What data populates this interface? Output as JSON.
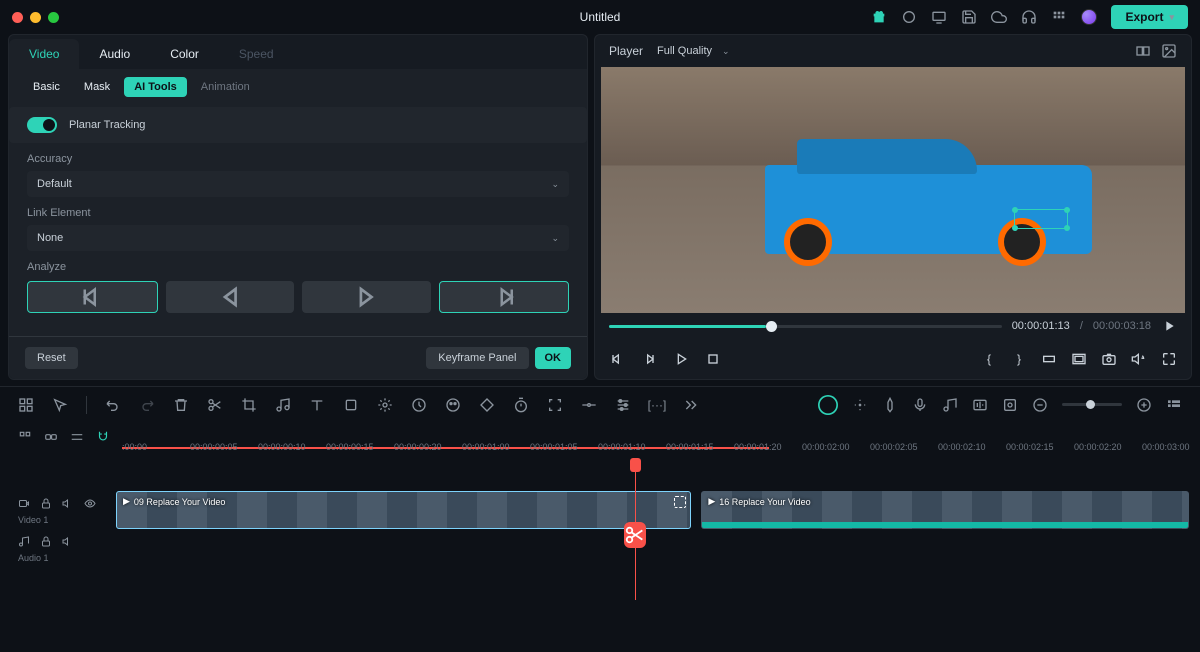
{
  "titlebar": {
    "title": "Untitled",
    "export_label": "Export"
  },
  "inspector": {
    "tabs": {
      "video": "Video",
      "audio": "Audio",
      "color": "Color",
      "speed": "Speed"
    },
    "subtabs": {
      "basic": "Basic",
      "mask": "Mask",
      "ai_tools": "AI Tools",
      "animation": "Animation"
    },
    "planar_tracking": {
      "title": "Planar Tracking",
      "accuracy_label": "Accuracy",
      "accuracy_value": "Default",
      "link_label": "Link Element",
      "link_value": "None",
      "analyze_label": "Analyze"
    },
    "footer": {
      "reset": "Reset",
      "keyframe_panel": "Keyframe Panel",
      "ok": "OK"
    }
  },
  "preview": {
    "player_label": "Player",
    "quality_label": "Full Quality",
    "current_time": "00:00:01:13",
    "total_time": "00:00:03:18"
  },
  "timeline": {
    "ticks": [
      ":00:00",
      "00:00:00:05",
      "00:00:00:10",
      "00:00:00:15",
      "00:00:00:20",
      "00:00:01:00",
      "00:00:01:05",
      "00:00:01:10",
      "00:00:01:15",
      "00:00:01:20",
      "00:00:02:00",
      "00:00:02:05",
      "00:00:02:10",
      "00:00:02:15",
      "00:00:02:20",
      "00:00:03:00"
    ],
    "tracks": {
      "video1_label": "Video 1",
      "audio1_label": "Audio 1",
      "clip1_label": "09 Replace Your Video",
      "clip2_label": "16 Replace Your Video"
    }
  }
}
